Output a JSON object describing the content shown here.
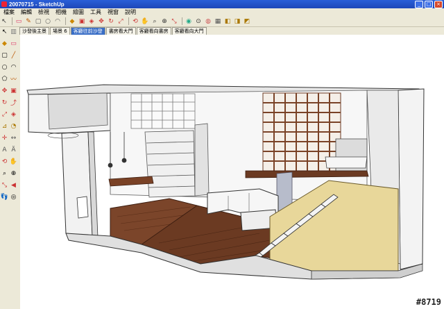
{
  "window": {
    "title": "20070715 - SketchUp"
  },
  "menu": [
    "檔案",
    "編輯",
    "檢視",
    "相機",
    "繪圖",
    "工具",
    "視窗",
    "說明"
  ],
  "toolbar_icons": [
    "select-icon",
    "eraser-icon",
    "pencil-icon",
    "rectangle-icon",
    "circle-icon",
    "arc-icon",
    "paint-icon",
    "push-pull-icon",
    "offset-icon",
    "move-icon",
    "rotate-icon",
    "scale-icon",
    "orbit-icon",
    "pan-icon",
    "zoom-icon",
    "zoom-window-icon",
    "zoom-extents-icon",
    "prev-view-icon",
    "next-view-icon",
    "iso-view-icon",
    "top-view-icon",
    "front-view-icon",
    "right-view-icon",
    "back-view-icon",
    "left-view-icon"
  ],
  "scene_tabs": [
    {
      "label": "沙發後主景",
      "active": false
    },
    {
      "label": "場景 6",
      "active": false
    },
    {
      "label": "客廳往前沙發",
      "active": true
    },
    {
      "label": "書房看大門",
      "active": false
    },
    {
      "label": "客廳看向書房",
      "active": false
    },
    {
      "label": "客廳看向大門",
      "active": false
    }
  ],
  "watermark": "#8719",
  "colors": {
    "titlebar": "#2a5fd8",
    "floor_wood": "#6b3a22",
    "stair_yellow": "#e8d79a",
    "wall": "#f2f2f2"
  }
}
